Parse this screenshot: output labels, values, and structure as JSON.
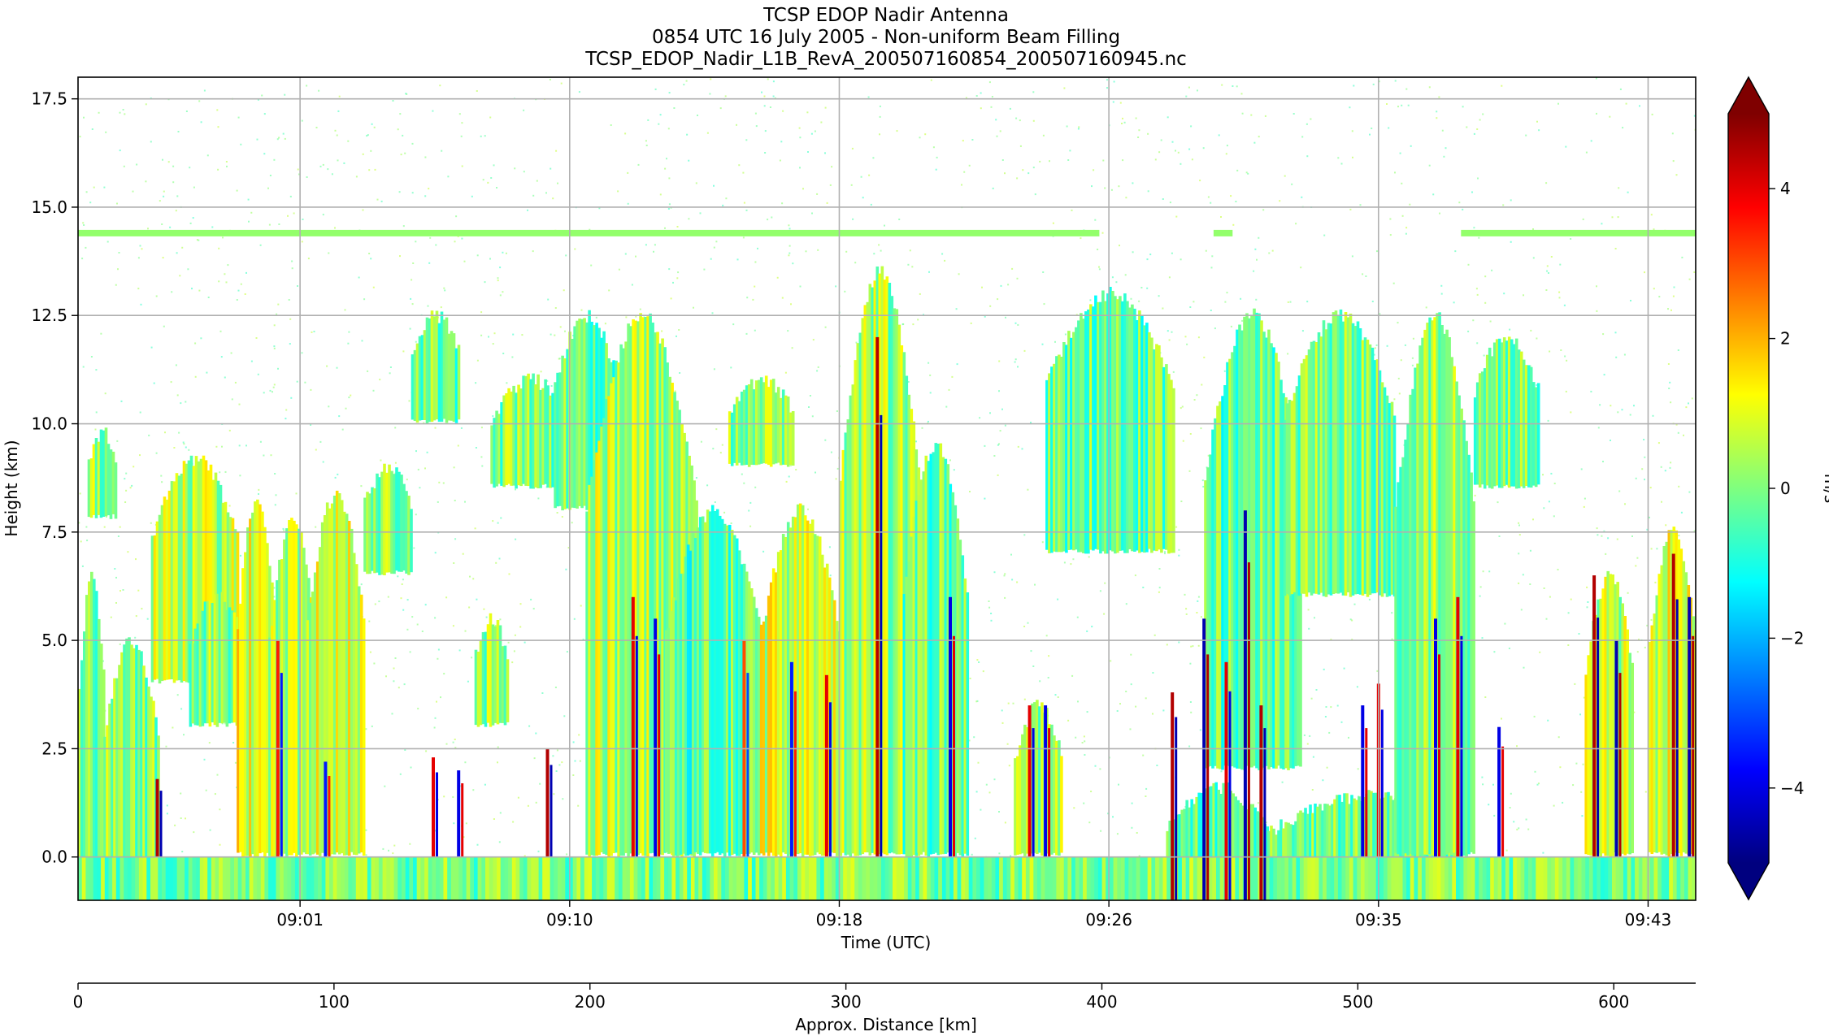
{
  "chart_data": {
    "type": "heatmap",
    "title_lines": [
      "TCSP EDOP Nadir Antenna",
      "0854 UTC 16 July 2005 - Non-uniform Beam Filling",
      "TCSP_EDOP_Nadir_L1B_RevA_200507160854_200507160945.nc"
    ],
    "xlabel": "Time (UTC)",
    "ylabel": "Height (km)",
    "x_range_minutes": [
      0,
      51
    ],
    "x_ticks": [
      {
        "minute": 7,
        "label": "09:01"
      },
      {
        "minute": 15.5,
        "label": "09:10"
      },
      {
        "minute": 24,
        "label": "09:18"
      },
      {
        "minute": 32.5,
        "label": "09:26"
      },
      {
        "minute": 41,
        "label": "09:35"
      },
      {
        "minute": 49.5,
        "label": "09:43"
      }
    ],
    "ylim": [
      -1,
      18
    ],
    "y_ticks": [
      {
        "value": 0,
        "label": "0.0"
      },
      {
        "value": 2.5,
        "label": "2.5"
      },
      {
        "value": 5,
        "label": "5.0"
      },
      {
        "value": 7.5,
        "label": "7.5"
      },
      {
        "value": 10,
        "label": "10.0"
      },
      {
        "value": 12.5,
        "label": "12.5"
      },
      {
        "value": 15,
        "label": "15.0"
      },
      {
        "value": 17.5,
        "label": "17.5"
      }
    ],
    "grid": true,
    "colorbar": {
      "label": "m/s",
      "range": [
        -5,
        5
      ],
      "ticks": [
        {
          "value": -4,
          "label": "−4"
        },
        {
          "value": -2,
          "label": "−2"
        },
        {
          "value": 0,
          "label": "0"
        },
        {
          "value": 2,
          "label": "2"
        },
        {
          "value": 4,
          "label": "4"
        }
      ],
      "colormap": [
        "#00007f",
        "#0000ff",
        "#007fff",
        "#00ffff",
        "#7fff7f",
        "#ffff00",
        "#ff7f00",
        "#ff0000",
        "#7f0000"
      ],
      "extend": "both"
    },
    "secondary_x": {
      "label": "Approx. Distance [km]",
      "range": [
        0,
        632
      ],
      "ticks": [
        {
          "value": 0,
          "label": "0"
        },
        {
          "value": 100,
          "label": "100"
        },
        {
          "value": 200,
          "label": "200"
        },
        {
          "value": 300,
          "label": "300"
        },
        {
          "value": 400,
          "label": "400"
        },
        {
          "value": 500,
          "label": "500"
        },
        {
          "value": 600,
          "label": "600"
        }
      ]
    },
    "field": {
      "background_value": 0,
      "bright_band_height_km": 14.4,
      "surface_height_km": 0,
      "cloud_columns": [
        {
          "x0": 0.0,
          "x1": 0.8,
          "bottom": -1.0,
          "top": 6.5,
          "value": -0.3
        },
        {
          "x0": 0.3,
          "x1": 1.2,
          "bottom": 7.8,
          "top": 9.8,
          "value": 0.2
        },
        {
          "x0": 0.8,
          "x1": 2.5,
          "bottom": -1.0,
          "top": 5.0,
          "value": 0.1
        },
        {
          "x0": 2.3,
          "x1": 5.0,
          "bottom": 4.0,
          "top": 9.2,
          "value": 0.5
        },
        {
          "x0": 3.5,
          "x1": 5.2,
          "bottom": 3.0,
          "top": 6.0,
          "value": 0.2
        },
        {
          "x0": 5.0,
          "x1": 6.2,
          "bottom": 0.0,
          "top": 8.3,
          "value": 1.0
        },
        {
          "x0": 6.0,
          "x1": 7.5,
          "bottom": 0.0,
          "top": 7.8,
          "value": 0.5
        },
        {
          "x0": 7.2,
          "x1": 9.0,
          "bottom": 0.0,
          "top": 8.4,
          "value": 0.7
        },
        {
          "x0": 9.0,
          "x1": 10.5,
          "bottom": 6.5,
          "top": 9.0,
          "value": 0.0
        },
        {
          "x0": 10.5,
          "x1": 12.0,
          "bottom": 10.0,
          "top": 12.5,
          "value": -0.2
        },
        {
          "x0": 12.5,
          "x1": 13.5,
          "bottom": 3.0,
          "top": 5.5,
          "value": 0.2
        },
        {
          "x0": 13.0,
          "x1": 15.5,
          "bottom": 8.5,
          "top": 11.0,
          "value": 0.0
        },
        {
          "x0": 15.0,
          "x1": 17.0,
          "bottom": 8.0,
          "top": 12.5,
          "value": -0.3
        },
        {
          "x0": 16.0,
          "x1": 19.5,
          "bottom": 0.0,
          "top": 12.5,
          "value": 0.5
        },
        {
          "x0": 18.5,
          "x1": 21.5,
          "bottom": 0.0,
          "top": 8.0,
          "value": -0.4
        },
        {
          "x0": 20.5,
          "x1": 22.5,
          "bottom": 9.0,
          "top": 11.0,
          "value": 0.2
        },
        {
          "x0": 21.5,
          "x1": 24.0,
          "bottom": 0.0,
          "top": 8.0,
          "value": 0.8
        },
        {
          "x0": 24.0,
          "x1": 26.5,
          "bottom": 0.0,
          "top": 13.5,
          "value": 0.3
        },
        {
          "x0": 26.0,
          "x1": 28.0,
          "bottom": 0.0,
          "top": 9.5,
          "value": -0.2
        },
        {
          "x0": 29.5,
          "x1": 31.0,
          "bottom": 0.0,
          "top": 3.5,
          "value": 0.3
        },
        {
          "x0": 30.5,
          "x1": 34.5,
          "bottom": 7.0,
          "top": 13.0,
          "value": -0.2
        },
        {
          "x0": 34.3,
          "x1": 37.5,
          "bottom": -1.0,
          "top": 1.6,
          "value": -0.5
        },
        {
          "x0": 35.5,
          "x1": 38.5,
          "bottom": 2.0,
          "top": 12.5,
          "value": -0.3
        },
        {
          "x0": 38.0,
          "x1": 41.5,
          "bottom": 6.0,
          "top": 12.5,
          "value": 0.0
        },
        {
          "x0": 37.5,
          "x1": 43.5,
          "bottom": -1.0,
          "top": 1.4,
          "value": -0.2
        },
        {
          "x0": 41.5,
          "x1": 44.0,
          "bottom": 0.0,
          "top": 12.5,
          "value": 0.2
        },
        {
          "x0": 44.0,
          "x1": 46.0,
          "bottom": 8.5,
          "top": 12.0,
          "value": 0.0
        },
        {
          "x0": 47.5,
          "x1": 49.0,
          "bottom": 0.0,
          "top": 6.5,
          "value": 0.5
        },
        {
          "x0": 49.5,
          "x1": 51.0,
          "bottom": 0.0,
          "top": 7.5,
          "value": 0.8
        }
      ],
      "updraft_streaks": [
        {
          "x": 2.5,
          "bottom": 0.0,
          "top": 1.8,
          "value": 4.5
        },
        {
          "x": 6.3,
          "bottom": 0.0,
          "top": 5.0,
          "value": 3.5
        },
        {
          "x": 7.8,
          "bottom": 0.0,
          "top": 2.2,
          "value": -3.5
        },
        {
          "x": 11.2,
          "bottom": 0.0,
          "top": 2.3,
          "value": 4.0
        },
        {
          "x": 12.0,
          "bottom": 0.0,
          "top": 2.0,
          "value": -4.0
        },
        {
          "x": 14.8,
          "bottom": 0.0,
          "top": 2.5,
          "value": 4.5
        },
        {
          "x": 17.5,
          "bottom": 0.0,
          "top": 6.0,
          "value": 4.0
        },
        {
          "x": 18.2,
          "bottom": 0.0,
          "top": 5.5,
          "value": -4.0
        },
        {
          "x": 21.0,
          "bottom": 0.0,
          "top": 5.0,
          "value": 3.0
        },
        {
          "x": 22.5,
          "bottom": 0.0,
          "top": 4.5,
          "value": -3.5
        },
        {
          "x": 23.6,
          "bottom": 0.0,
          "top": 4.2,
          "value": 4.0
        },
        {
          "x": 25.2,
          "bottom": 0.0,
          "top": 12.0,
          "value": 4.5
        },
        {
          "x": 27.5,
          "bottom": 0.0,
          "top": 6.0,
          "value": -4.0
        },
        {
          "x": 30.0,
          "bottom": 0.0,
          "top": 3.5,
          "value": 4.0
        },
        {
          "x": 30.5,
          "bottom": 0.0,
          "top": 3.5,
          "value": -4.0
        },
        {
          "x": 34.5,
          "bottom": -1.0,
          "top": 3.8,
          "value": 4.5
        },
        {
          "x": 35.5,
          "bottom": -1.0,
          "top": 5.5,
          "value": -4.5
        },
        {
          "x": 36.2,
          "bottom": -1.0,
          "top": 4.5,
          "value": 4.0
        },
        {
          "x": 36.8,
          "bottom": -1.0,
          "top": 8.0,
          "value": -4.5
        },
        {
          "x": 37.3,
          "bottom": -1.0,
          "top": 3.5,
          "value": 4.5
        },
        {
          "x": 40.5,
          "bottom": 0.0,
          "top": 3.5,
          "value": -4.0
        },
        {
          "x": 41.0,
          "bottom": 0.0,
          "top": 4.0,
          "value": 4.0
        },
        {
          "x": 42.8,
          "bottom": 0.0,
          "top": 5.5,
          "value": -4.0
        },
        {
          "x": 43.5,
          "bottom": 0.0,
          "top": 6.0,
          "value": 4.0
        },
        {
          "x": 44.8,
          "bottom": 0.0,
          "top": 3.0,
          "value": -4.0
        },
        {
          "x": 47.8,
          "bottom": 0.0,
          "top": 6.5,
          "value": 4.5
        },
        {
          "x": 48.5,
          "bottom": 0.0,
          "top": 5.0,
          "value": -4.5
        },
        {
          "x": 50.3,
          "bottom": 0.0,
          "top": 7.0,
          "value": 4.5
        },
        {
          "x": 50.8,
          "bottom": 0.0,
          "top": 6.0,
          "value": -4.5
        }
      ]
    }
  }
}
